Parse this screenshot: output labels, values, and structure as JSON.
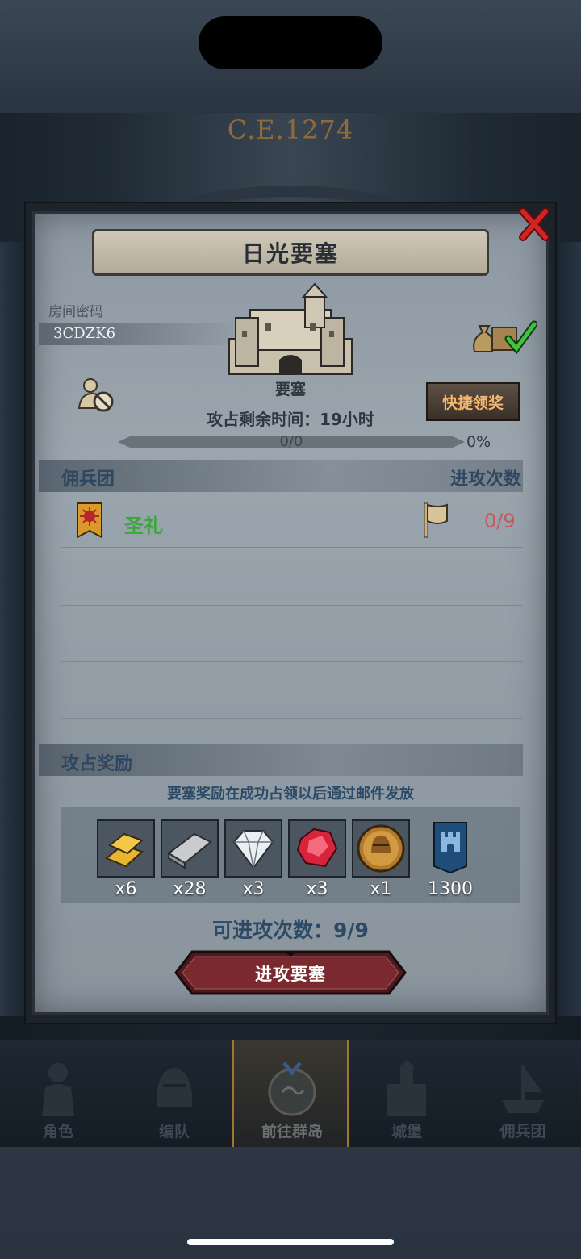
{
  "header": {
    "era": "C.E.1274"
  },
  "modal": {
    "title": "日光要塞",
    "room_label": "房间密码",
    "room_code": "3CDZK6",
    "fortress_name": "要塞",
    "time_left": "攻占剩余时间：19小时",
    "quick_claim_label": "快捷领奖",
    "progress": {
      "text": "0/0",
      "percent_text": "0%",
      "value": 0
    },
    "mercenary_section": {
      "title": "佣兵团",
      "count_header": "进攻次数"
    },
    "mercenaries": [
      {
        "name": "圣礼",
        "attacks": "0/9"
      }
    ],
    "reward_section": {
      "title": "攻占奖励",
      "note": "要塞奖励在成功占领以后通过邮件发放"
    },
    "rewards": [
      {
        "icon": "gold-bars-icon",
        "qty": "x6"
      },
      {
        "icon": "silver-ingot-icon",
        "qty": "x28"
      },
      {
        "icon": "diamond-icon",
        "qty": "x3"
      },
      {
        "icon": "ruby-icon",
        "qty": "x3"
      },
      {
        "icon": "knight-helmet-medal-icon",
        "qty": "x1"
      },
      {
        "icon": "castle-shield-icon",
        "qty": "1300"
      }
    ],
    "attacks_available": "可进攻次数：9/9",
    "attack_button_label": "进攻要塞"
  },
  "nav": {
    "items": [
      {
        "label": "角色",
        "icon": "knight-icon",
        "active": false
      },
      {
        "label": "编队",
        "icon": "helmet-icon",
        "active": false
      },
      {
        "label": "前往群岛",
        "icon": "compass-map-icon",
        "active": true
      },
      {
        "label": "城堡",
        "icon": "castle-icon",
        "active": false
      },
      {
        "label": "佣兵团",
        "icon": "ship-icon",
        "active": false
      }
    ]
  },
  "colors": {
    "accent_orange": "#f3b66c",
    "merc_green": "#3aa83a",
    "count_red": "#c25a5a",
    "title_blue": "#2e4760"
  }
}
